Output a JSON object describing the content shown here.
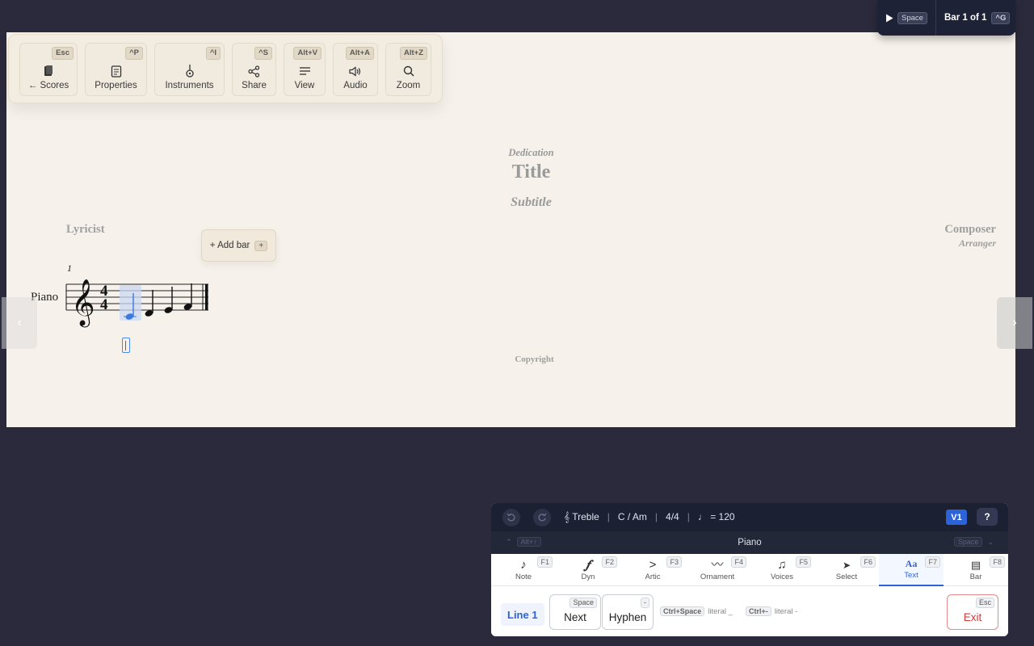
{
  "toolbar": {
    "buttons": [
      {
        "label": "← Scores",
        "kbd": "Esc",
        "icon": "book-icon"
      },
      {
        "label": "Properties",
        "kbd": "^P",
        "icon": "document-icon"
      },
      {
        "label": "Instruments",
        "kbd": "^I",
        "icon": "guitar-icon"
      },
      {
        "label": "Share",
        "kbd": "^S",
        "icon": "share-icon"
      },
      {
        "label": "View",
        "kbd": "Alt+V",
        "icon": "lines-icon"
      },
      {
        "label": "Audio",
        "kbd": "Alt+A",
        "icon": "speaker-icon"
      },
      {
        "label": "Zoom",
        "kbd": "Alt+Z",
        "icon": "magnifier-icon"
      }
    ]
  },
  "score": {
    "dedication": "Dedication",
    "title": "Title",
    "subtitle": "Subtitle",
    "lyricist": "Lyricist",
    "composer": "Composer",
    "arranger": "Arranger",
    "copyright": "Copyright",
    "bar_number": "1",
    "instrument": "Piano",
    "time_signature": "4/4",
    "add_bar_label": "+ Add bar",
    "add_bar_kbd": "+"
  },
  "transport": {
    "play_kbd": "Space",
    "bar_label": "Bar 1 of 1",
    "bar_kbd": "^G"
  },
  "palette": {
    "status": {
      "clef": "𝄞 Treble",
      "key": "C / Am",
      "time": "4/4",
      "tempo": "♩ = 120"
    },
    "voice_badge": "V1",
    "help_label": "?",
    "instrument_name": "Piano",
    "prev_kbd": "Alt+↑",
    "next_kbd": "Space",
    "tabs": [
      {
        "label": "Note",
        "kbd": "F1",
        "icon": "♪"
      },
      {
        "label": "Dyn",
        "kbd": "F2",
        "icon": "𝆑"
      },
      {
        "label": "Artic",
        "kbd": "F3",
        "icon": ">"
      },
      {
        "label": "Ornament",
        "kbd": "F4",
        "icon": "〰"
      },
      {
        "label": "Voices",
        "kbd": "F5",
        "icon": "♫"
      },
      {
        "label": "Select",
        "kbd": "F6",
        "icon": "➤"
      },
      {
        "label": "Text",
        "kbd": "F7",
        "icon": "Aa"
      },
      {
        "label": "Bar",
        "kbd": "F8",
        "icon": "▤"
      }
    ],
    "active_tab": "Text",
    "line_label": "Line 1",
    "next_label": "Next",
    "hyphen_label": "Hyphen",
    "hyphen_kbd": "-",
    "hint1_kbd": "Ctrl+Space",
    "hint1_text": "literal _",
    "hint2_kbd": "Ctrl+-",
    "hint2_text": "literal -",
    "exit_label": "Exit",
    "exit_kbd": "Esc"
  },
  "colors": {
    "accent": "#2c63d8",
    "page": "#f6f1ea",
    "background": "#2a2a3c",
    "exit": "#d13a3a"
  }
}
